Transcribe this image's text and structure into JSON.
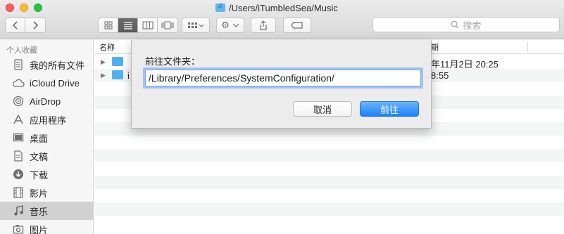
{
  "window": {
    "title": "/Users/iTumbledSea/Music"
  },
  "toolbar": {
    "back_icon": "chevron-left-icon",
    "forward_icon": "chevron-right-icon",
    "view_modes": [
      "icon-view",
      "list-view",
      "column-view",
      "cover-flow-view"
    ],
    "active_view": "list-view",
    "search_placeholder": "搜索"
  },
  "sidebar": {
    "section_title": "个人收藏",
    "items": [
      {
        "label": "我的所有文件",
        "icon": "all-files-icon",
        "selected": false
      },
      {
        "label": "iCloud Drive",
        "icon": "cloud-icon",
        "selected": false
      },
      {
        "label": "AirDrop",
        "icon": "airdrop-icon",
        "selected": false
      },
      {
        "label": "应用程序",
        "icon": "applications-icon",
        "selected": false
      },
      {
        "label": "桌面",
        "icon": "desktop-icon",
        "selected": false
      },
      {
        "label": "文稿",
        "icon": "documents-icon",
        "selected": false
      },
      {
        "label": "下载",
        "icon": "download-icon",
        "selected": false
      },
      {
        "label": "影片",
        "icon": "movies-icon",
        "selected": false
      },
      {
        "label": "音乐",
        "icon": "music-icon",
        "selected": true
      },
      {
        "label": "图片",
        "icon": "pictures-icon",
        "selected": false
      }
    ]
  },
  "file_list": {
    "columns": {
      "name": "名称",
      "date": "期"
    },
    "rows": [
      {
        "name": "",
        "date": "年11月2日 20:25"
      },
      {
        "name": "i",
        "date": "8:55"
      }
    ]
  },
  "dialog": {
    "label": "前往文件夹：",
    "path_value": "/Library/Preferences/SystemConfiguration/",
    "cancel_label": "取消",
    "go_label": "前往"
  },
  "colors": {
    "accent": "#1a82fb",
    "folder": "#4fb0ef",
    "selected_sidebar": "#d1d1d1"
  }
}
